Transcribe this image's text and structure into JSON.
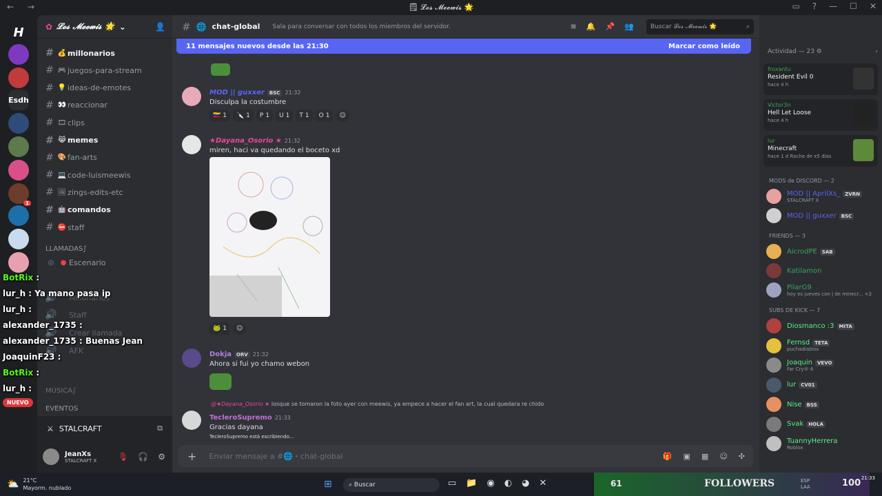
{
  "window": {
    "title": "🗒 𝓛𝓸𝓼 𝓜𝓮𝓮𝔀𝓲𝓼 🌟"
  },
  "guilds": {
    "server_label": "Esdh",
    "badge": "1"
  },
  "server": {
    "name": "𝓛𝓸𝓼 𝓜𝓮𝓮𝔀𝓲𝓼 🌟"
  },
  "channels": [
    {
      "emoji": "💰",
      "name": "millonarios",
      "bold": true
    },
    {
      "emoji": "🎮",
      "name": "juegos-para-stream",
      "bold": false
    },
    {
      "emoji": "💡",
      "name": "ideas-de-emotes",
      "bold": false
    },
    {
      "emoji": "👀",
      "name": "reaccionar",
      "bold": false
    },
    {
      "emoji": "🎞",
      "name": "clips",
      "bold": false
    },
    {
      "emoji": "😹",
      "name": "memes",
      "bold": true
    },
    {
      "emoji": "🎨",
      "name": "fan-arts",
      "bold": false
    },
    {
      "emoji": "💻",
      "name": "code-luismeewis",
      "bold": false
    },
    {
      "emoji": "🖼",
      "name": "zings-edits-etc",
      "bold": false
    },
    {
      "emoji": "🤖",
      "name": "comandos",
      "bold": true
    },
    {
      "emoji": "⛔",
      "name": "staff",
      "bold": false
    }
  ],
  "voice": {
    "category": "LLAMADAS∫",
    "items": [
      "Escenario",
      "Millonarios",
      "Staff",
      "Crear llamada",
      "AFK"
    ],
    "music": "MÚSICA∫",
    "events": "EVENTOS"
  },
  "overlay_chat": [
    {
      "user": "BotRix",
      "text": ""
    },
    {
      "user": "lur_h",
      "text": "Ya mano pasa ip"
    },
    {
      "user": "lur_h",
      "text": ""
    },
    {
      "user": "alexander_1735",
      "text": ""
    },
    {
      "user": "alexander_1735",
      "text": "Buenas Jean"
    },
    {
      "user": "JoaquinF23",
      "text": ""
    },
    {
      "user": "BotRix",
      "text": ""
    },
    {
      "user": "lur_h",
      "text": ""
    }
  ],
  "nuevo_badge": "NUEVO",
  "voice_connected": {
    "name": "STALCRAFT"
  },
  "user": {
    "name": "JeanXs",
    "status": "STALCRAFT X"
  },
  "channel": {
    "name": "chat-global",
    "topic": "Sala para conversar con todos los miembros del servidor.",
    "search_placeholder": "Buscar 𝓛𝓸𝓼 𝓜𝓮𝓮𝔀𝓲𝓼 🌟"
  },
  "banner": {
    "text": "11 mensajes nuevos desde las 21:30",
    "action": "Marcar como leído"
  },
  "messages": [
    {
      "author": "MOD || guxxer",
      "tag": "BSC",
      "time": "21:32",
      "text": "Disculpa la costumbre",
      "color": "#5865f2",
      "reactions": [
        {
          "e": "🇻🇪",
          "n": "1"
        },
        {
          "e": "🔪",
          "n": "1"
        },
        {
          "e": "P",
          "n": "1"
        },
        {
          "e": "U",
          "n": "1"
        },
        {
          "e": "T",
          "n": "1"
        },
        {
          "e": "O",
          "n": "1"
        }
      ]
    },
    {
      "author": "★Dayana_Osorio ★",
      "tag": "",
      "time": "21:32",
      "text": "miren, haci va quedando el boceto xd",
      "color": "#eb459e",
      "reactions": [
        {
          "e": "🐸",
          "n": "1"
        }
      ]
    },
    {
      "author": "Dokja",
      "tag": "ORV",
      "time": "21:32",
      "text": "Ahora si fui yo chamo webon",
      "color": "#b57edc",
      "reactions": []
    },
    {
      "author": "TecleroSupremo",
      "tag": "",
      "time": "21:33",
      "text": "Gracias dayana",
      "color": "#c270d6",
      "reactions": []
    }
  ],
  "reply_preview": {
    "author": "@★Dayana_Osorio ★",
    "text": "losque se tomaron la foto ayer con meewis, ya empece a hacer el fan art, la cual quedara re chido"
  },
  "typing": "TecleroSupremo está escribiendo...",
  "composer": {
    "placeholder": "Enviar mensaje a #🌐・chat-global"
  },
  "activity": {
    "title": "Actividad — 23 ⚙",
    "items": [
      {
        "user": "froxantu",
        "game": "Resident Evil 0",
        "time": "hace 4 h"
      },
      {
        "user": "Victor3n",
        "game": "Hell Let Loose",
        "time": "hace 4 h"
      },
      {
        "user": "lur",
        "game": "Minecraft",
        "time": "hace 1 d",
        "extra": "Racha de x5 días"
      }
    ]
  },
  "member_groups": [
    {
      "title": "MODS de DISCORD — 2",
      "members": [
        {
          "name": "MOD || AprilXs_",
          "tag": "ZVRN",
          "sub": "STALCRAFT X",
          "color": "#5865f2"
        },
        {
          "name": "MOD || guxxer",
          "tag": "BSC",
          "sub": "",
          "color": "#5865f2"
        }
      ]
    },
    {
      "title": "FRIENDS — 3",
      "members": [
        {
          "name": "AicrodPE",
          "tag": "SAB",
          "sub": "",
          "color": "#3ba55d"
        },
        {
          "name": "Katilamon",
          "tag": "",
          "sub": "",
          "color": "#3ba55d"
        },
        {
          "name": "PilarG9",
          "tag": "",
          "sub": "hoy es jueves con j de minecr... +2",
          "color": "#3ba55d"
        }
      ]
    },
    {
      "title": "SUBS DE KICK — 7",
      "members": [
        {
          "name": "Diosmanco :3",
          "tag": "MITA",
          "sub": "",
          "color": "#57f287"
        },
        {
          "name": "Fernsd",
          "tag": "TETA",
          "sub": "puchadiablos",
          "color": "#57f287"
        },
        {
          "name": "Joaquin",
          "tag": "VEVO",
          "sub": "Far Cry® 6",
          "color": "#57f287"
        },
        {
          "name": "lur",
          "tag": "CV01",
          "sub": "",
          "color": "#57f287"
        },
        {
          "name": "Nise",
          "tag": "BSS",
          "sub": "",
          "color": "#57f287"
        },
        {
          "name": "Svak",
          "tag": "HOLA",
          "sub": "",
          "color": "#57f287"
        },
        {
          "name": "TuannyHerrera",
          "tag": "",
          "sub": "Roblox",
          "color": "#57f287"
        }
      ]
    }
  ],
  "taskbar": {
    "temp": "21°C",
    "weather": "Mayorm. nublado",
    "search": "Buscar",
    "followers_count": "61",
    "followers_label": "FOLLOWERS",
    "goal": "100",
    "lang": "ESP",
    "lang2": "LAA",
    "time": "21:33"
  }
}
